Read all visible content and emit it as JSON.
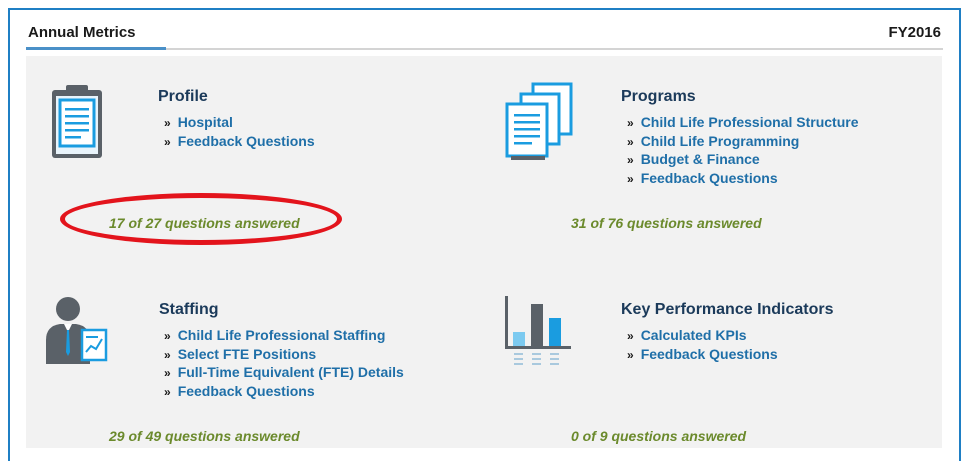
{
  "header": {
    "title": "Annual Metrics",
    "year": "FY2016"
  },
  "sections": [
    {
      "title": "Profile",
      "icon": "clipboard-icon",
      "links": [
        "Hospital",
        "Feedback Questions"
      ],
      "answered": "17 of 27 questions answered"
    },
    {
      "title": "Programs",
      "icon": "documents-icon",
      "links": [
        "Child Life Professional Structure",
        "Child Life Programming",
        "Budget & Finance",
        "Feedback Questions"
      ],
      "answered": "31 of 76 questions answered"
    },
    {
      "title": "Staffing",
      "icon": "person-chart-icon",
      "links": [
        "Child Life Professional Staffing",
        "Select FTE Positions",
        "Full-Time Equivalent (FTE) Details",
        "Feedback Questions"
      ],
      "answered": "29 of 49 questions answered"
    },
    {
      "title": "Key Performance Indicators",
      "icon": "bar-chart-icon",
      "links": [
        "Calculated KPIs",
        "Feedback Questions"
      ],
      "answered": "0 of 9 questions answered"
    }
  ],
  "link_prefix": "»",
  "colors": {
    "frame": "#1f7fc4",
    "link": "#1f6fa8",
    "answered": "#6b8a2c",
    "highlight": "#e3141c",
    "icon_blue": "#1a9ce0"
  }
}
